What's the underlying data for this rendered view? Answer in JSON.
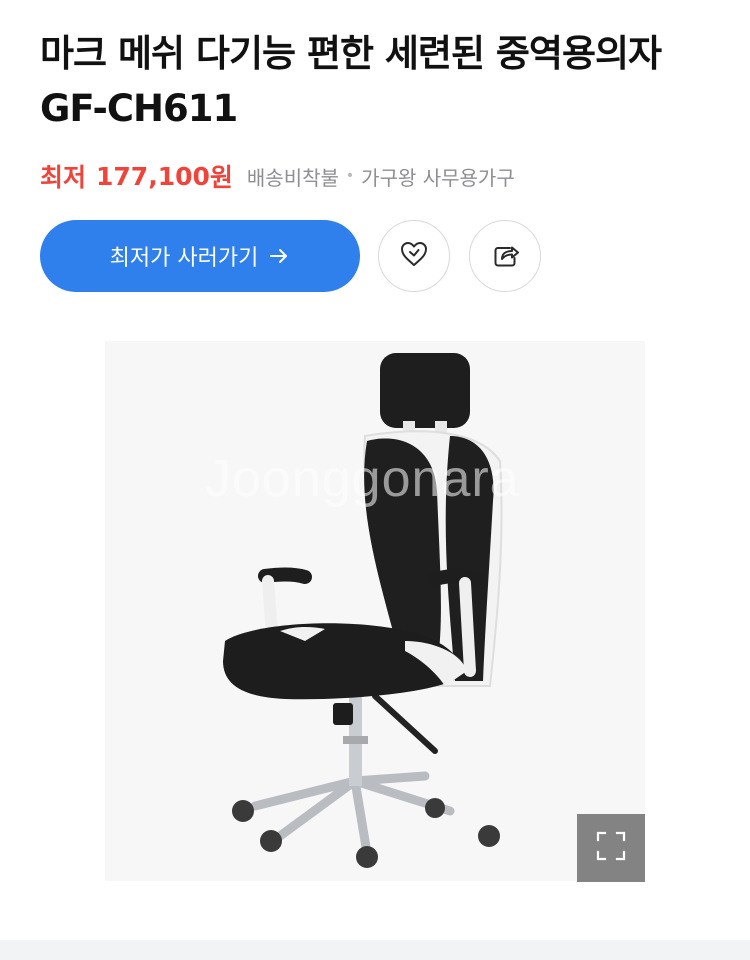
{
  "product": {
    "title": "마크 메쉬 다기능 편한 세련된 중역용의자 GF-CH611"
  },
  "price": {
    "label": "최저",
    "value": "177,100",
    "unit": "원",
    "shipping": "배송비착불",
    "separator": "•",
    "seller": "가구왕 사무용가구"
  },
  "actions": {
    "buy_label": "최저가 사러가기",
    "like_icon": "heart-outline-icon",
    "share_icon": "share-icon",
    "zoom_icon": "expand-icon"
  },
  "image": {
    "watermark": "Joonggonara"
  },
  "colors": {
    "price": "#f0433a",
    "primary": "#2f80ed",
    "muted": "#8e8e93"
  }
}
